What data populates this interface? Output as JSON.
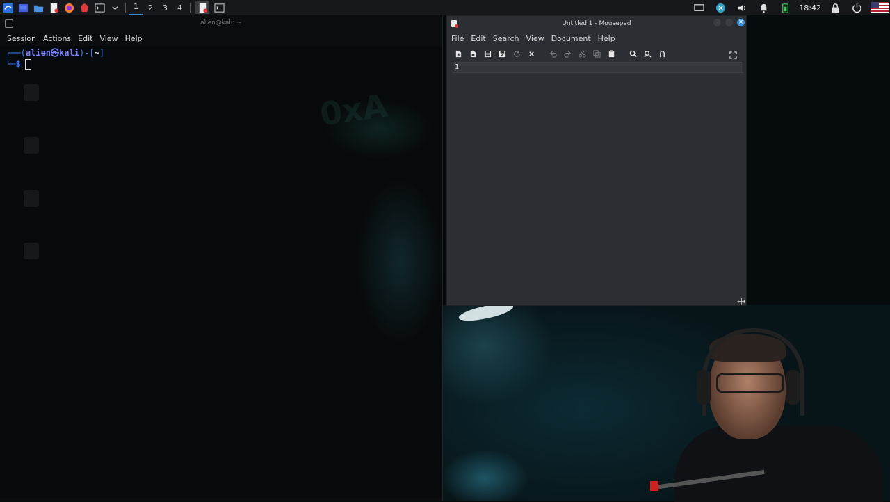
{
  "panel": {
    "workspaces": [
      "1",
      "2",
      "3",
      "4"
    ],
    "active_workspace": "1",
    "clock": "18:42"
  },
  "terminal": {
    "window_title": "alien@kali: ~",
    "menu": [
      "Session",
      "Actions",
      "Edit",
      "View",
      "Help"
    ],
    "prompt_user": "alien㉿kali",
    "prompt_path": "~",
    "prompt_line1_prefix": "┌──(",
    "prompt_line1_mid": ")-[",
    "prompt_line1_suffix": "]",
    "prompt_line2": "└─$"
  },
  "mousepad": {
    "window_title": "Untitled 1 - Mousepad",
    "menu": [
      "File",
      "Edit",
      "Search",
      "View",
      "Document",
      "Help"
    ],
    "line_number": "1",
    "content": ""
  },
  "colors": {
    "accent": "#3a8fd9",
    "prompt_blue": "#3b82f6",
    "prompt_user": "#7c83ff",
    "editor_bg": "#2b2e33"
  }
}
